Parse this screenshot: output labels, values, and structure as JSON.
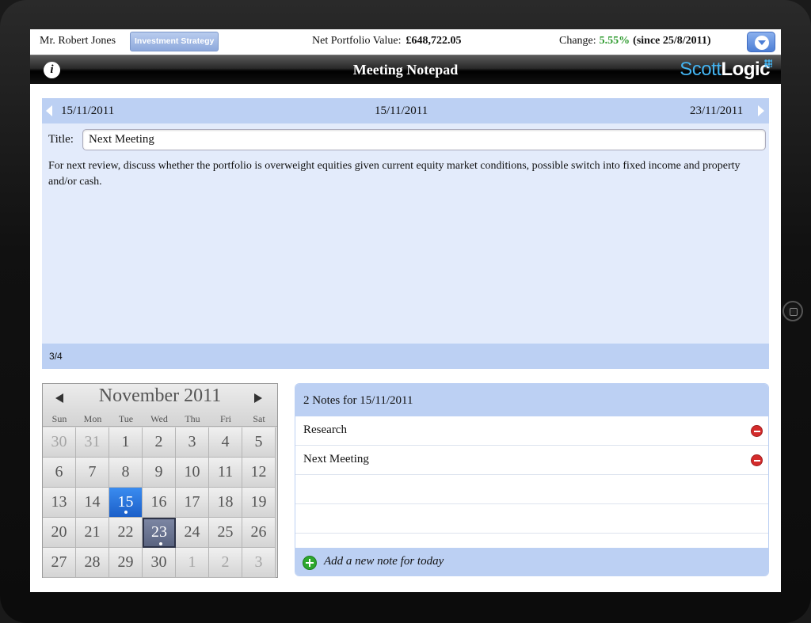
{
  "status": {
    "client": "Mr. Robert Jones",
    "strategy_label": "Investment Strategy",
    "npv_label": "Net Portfolio Value:",
    "npv_value": "£648,722.05",
    "change_label": "Change:",
    "change_value": "5.55%",
    "change_since": "(since 25/8/2011)",
    "change_color": "#2f9b2f"
  },
  "titlebar": {
    "title": "Meeting Notepad",
    "logo_left": "Scott",
    "logo_right": "Logic",
    "logo_color": "#43b3f0"
  },
  "note": {
    "prev_date": "15/11/2011",
    "current_date": "15/11/2011",
    "next_date": "23/11/2011",
    "title_label": "Title:",
    "title_value": "Next Meeting",
    "body": "For next review, discuss whether the portfolio is overweight equities given current equity market conditions, possible switch into fixed income and property and/or cash.",
    "page_indicator": "3/4"
  },
  "calendar": {
    "month_label": "November 2011",
    "weekdays": [
      "Sun",
      "Mon",
      "Tue",
      "Wed",
      "Thu",
      "Fri",
      "Sat"
    ],
    "weeks": [
      [
        "30",
        "31",
        "1",
        "2",
        "3",
        "4",
        "5"
      ],
      [
        "6",
        "7",
        "8",
        "9",
        "10",
        "11",
        "12"
      ],
      [
        "13",
        "14",
        "15",
        "16",
        "17",
        "18",
        "19"
      ],
      [
        "20",
        "21",
        "22",
        "23",
        "24",
        "25",
        "26"
      ],
      [
        "27",
        "28",
        "29",
        "30",
        "1",
        "2",
        "3"
      ]
    ],
    "selected_day": "15",
    "highlighted_day": "23",
    "days_with_notes": [
      "15",
      "23"
    ]
  },
  "notes_list": {
    "header": "2 Notes for 15/11/2011",
    "items": [
      "Research",
      "Next Meeting"
    ],
    "add_label": "Add a new note for today"
  },
  "colors": {
    "panel": "#e3ebfb",
    "bar": "#bcd0f3",
    "selected": "#1c5fc8",
    "delete": "#d42b2b",
    "add": "#2ea82e"
  }
}
